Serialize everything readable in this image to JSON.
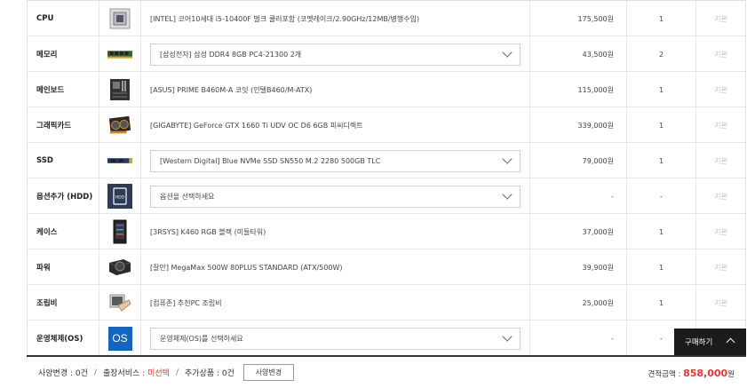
{
  "rows": [
    {
      "label": "CPU",
      "name": "[INTEL] 코어10세대 i5-10400F 벌크 쿨러포함 (코멧레이크/2.90GHz/12MB/병행수입)",
      "price": "175,500원",
      "qty": "1",
      "status": "기본",
      "dropdown": false,
      "icon": "cpu-chip-icon"
    },
    {
      "label": "메모리",
      "name": "[삼성전자] 삼성 DDR4 8GB PC4-21300 2개",
      "price": "43,500원",
      "qty": "2",
      "status": "기본",
      "dropdown": true,
      "icon": "ram-stick-icon"
    },
    {
      "label": "메인보드",
      "name": "[ASUS] PRIME B460M-A 코잇 (인텔B460/M-ATX)",
      "price": "115,000원",
      "qty": "1",
      "status": "기본",
      "dropdown": false,
      "icon": "motherboard-icon"
    },
    {
      "label": "그래픽카드",
      "name": "[GIGABYTE] GeForce GTX 1660 Ti UDV OC D6 6GB 피씨디렉트",
      "price": "339,000원",
      "qty": "1",
      "status": "기본",
      "dropdown": false,
      "icon": "graphics-card-icon"
    },
    {
      "label": "SSD",
      "name": "[Western Digital] Blue NVMe SSD SN550 M.2 2280 500GB TLC",
      "price": "79,000원",
      "qty": "1",
      "status": "기본",
      "dropdown": true,
      "icon": "ssd-icon"
    },
    {
      "label": "옵션추가 (HDD)",
      "name": "옵션을 선택하세요",
      "price": "-",
      "qty": "-",
      "status": "기본",
      "dropdown": true,
      "icon": "hdd-icon"
    },
    {
      "label": "케이스",
      "name": "[3RSYS] K460 RGB 블랙 (미들타워)",
      "price": "37,000원",
      "qty": "1",
      "status": "기본",
      "dropdown": false,
      "icon": "pc-case-icon"
    },
    {
      "label": "파워",
      "name": "[잘만] MegaMax 500W 80PLUS STANDARD (ATX/500W)",
      "price": "39,900원",
      "qty": "1",
      "status": "기본",
      "dropdown": false,
      "icon": "power-supply-icon"
    },
    {
      "label": "조립비",
      "name": "[컴퓨존] 추천PC 조립비",
      "price": "25,000원",
      "qty": "1",
      "status": "기본",
      "dropdown": false,
      "icon": "assembly-icon"
    },
    {
      "label": "운영체제(OS)",
      "name": "운영체제(OS)를 선택하세요",
      "price": "-",
      "qty": "-",
      "status": "기본",
      "dropdown": true,
      "icon": "os-icon",
      "icon_text": "OS"
    }
  ],
  "hdd_icon_text": "HDD",
  "floating": {
    "buy_label": "구매하기"
  },
  "footer": {
    "spec_change": "사양변경 : 0건",
    "delivery_label": "출장서비스 : ",
    "delivery_value": "미선택",
    "extra": "추가상품 : 0건",
    "spec_button": "사양변경",
    "total_label": "견적금액 : ",
    "total_amount": "858,000",
    "total_unit": "원"
  },
  "colors": {
    "accent_red": "#e33333",
    "os_blue": "#1565c0",
    "dark": "#1b1b1b"
  }
}
